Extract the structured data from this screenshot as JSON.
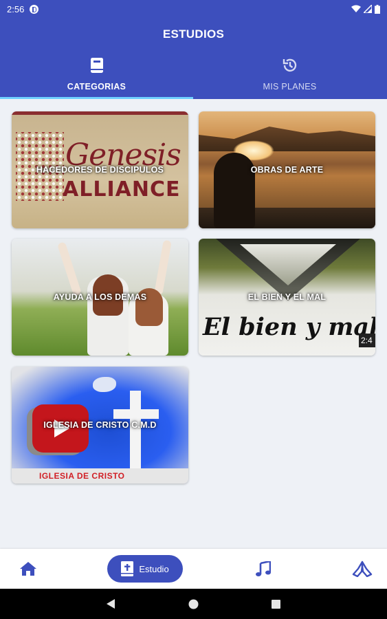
{
  "status_bar": {
    "time": "2:56"
  },
  "app_bar": {
    "title": "ESTUDIOS"
  },
  "tabs": [
    {
      "label": "CATEGORIAS",
      "icon": "book-icon",
      "active": true
    },
    {
      "label": "MIS PLANES",
      "icon": "history-icon",
      "active": false
    }
  ],
  "categories": [
    {
      "label": "HACEDORES DE DISCIPULOS",
      "image_text_1": "Genesis",
      "image_text_2": "ALLIANCE"
    },
    {
      "label": "OBRAS DE ARTE"
    },
    {
      "label": "AYUDA A LOS DEMAS"
    },
    {
      "label": "EL BIEN Y EL MAL",
      "image_text_1": "El bien y mal",
      "image_text_2": "2:4"
    },
    {
      "label": "IGLESIA DE CRISTO C.M.D",
      "image_text_1": "IGLESIA DE CRISTO"
    }
  ],
  "bottom_nav": {
    "items": [
      {
        "icon": "home-icon"
      },
      {
        "icon": "bible-icon",
        "label": "Estudio",
        "active": true
      },
      {
        "icon": "music-note-icon"
      },
      {
        "icon": "praying-hands-icon"
      }
    ]
  },
  "colors": {
    "primary": "#3d4fbd",
    "tab_indicator": "#6fd0ff",
    "background": "#eef1f6"
  }
}
